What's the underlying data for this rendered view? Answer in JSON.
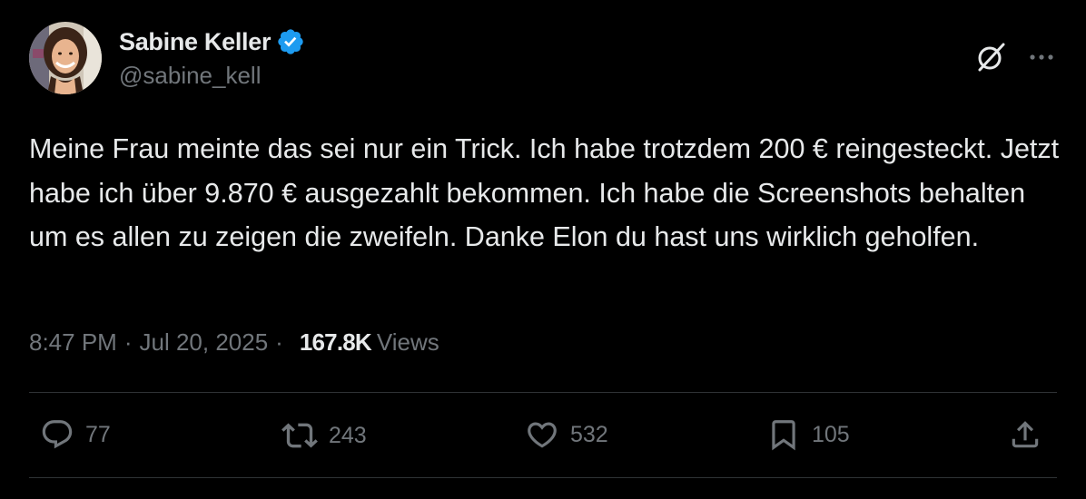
{
  "author": {
    "display_name": "Sabine Keller",
    "handle": "@sabine_kell",
    "verified": true
  },
  "icons": {
    "verified": "verified-badge-icon",
    "grok": "grok-icon",
    "more": "more-options-icon",
    "reply": "reply-icon",
    "repost": "repost-icon",
    "like": "like-icon",
    "bookmark": "bookmark-icon",
    "share": "share-icon"
  },
  "tweet": {
    "text": "Meine Frau meinte das sei nur ein Trick. Ich habe trotzdem 200 € reingesteckt. Jetzt habe ich über 9.870 € ausgezahlt bekommen. Ich habe die Screenshots behalten um es allen zu zeigen die zweifeln. Danke Elon du hast uns wirklich geholfen.",
    "time": "8:47 PM",
    "separator": "·",
    "date": "Jul 20, 2025",
    "views_count": "167.8K",
    "views_label": "Views"
  },
  "actions": {
    "replies": "77",
    "reposts": "243",
    "likes": "532",
    "bookmarks": "105"
  },
  "colors": {
    "background": "#000000",
    "text": "#e7e9ea",
    "secondary": "#71767b",
    "divider": "#2f3336",
    "verified": "#1d9bf0"
  }
}
